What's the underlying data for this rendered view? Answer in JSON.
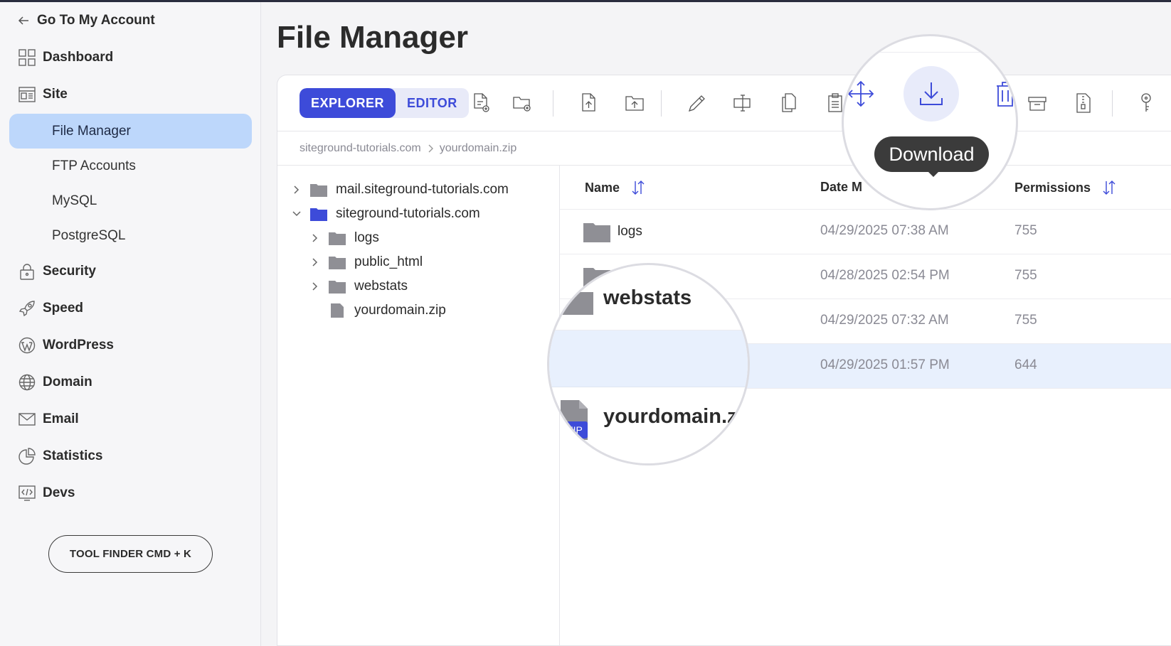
{
  "sidebar": {
    "back_label": "Go To My Account",
    "items": [
      {
        "label": "Dashboard",
        "icon": "dashboard-icon"
      },
      {
        "label": "Site",
        "icon": "site-icon"
      }
    ],
    "site_sub": [
      "File Manager",
      "FTP Accounts",
      "MySQL",
      "PostgreSQL"
    ],
    "items2": [
      {
        "label": "Security",
        "icon": "lock-icon"
      },
      {
        "label": "Speed",
        "icon": "rocket-icon"
      },
      {
        "label": "WordPress",
        "icon": "wordpress-icon"
      },
      {
        "label": "Domain",
        "icon": "globe-icon"
      },
      {
        "label": "Email",
        "icon": "envelope-icon"
      },
      {
        "label": "Statistics",
        "icon": "pie-chart-icon"
      },
      {
        "label": "Devs",
        "icon": "code-icon"
      }
    ],
    "tool_finder": "TOOL FINDER CMD + K"
  },
  "main": {
    "title": "File Manager",
    "tabs": [
      "EXPLORER",
      "EDITOR"
    ],
    "breadcrumb": [
      "siteground-tutorials.com",
      "yourdomain.zip"
    ],
    "tree": [
      {
        "label": "mail.siteground-tutorials.com"
      },
      {
        "label": "siteground-tutorials.com"
      },
      {
        "label": "logs"
      },
      {
        "label": "public_html"
      },
      {
        "label": "webstats"
      },
      {
        "label": "yourdomain.zip"
      }
    ],
    "columns": {
      "name": "Name",
      "date": "Date M",
      "permissions": "Permissions"
    },
    "rows": [
      {
        "name": "logs",
        "date": "04/29/2025 07:38 AM",
        "perm": "755"
      },
      {
        "name": "",
        "date": "04/28/2025 02:54 PM",
        "perm": "755"
      },
      {
        "name": "",
        "date": "04/29/2025 07:32 AM",
        "perm": "755"
      },
      {
        "name": "",
        "date": "04/29/2025 01:57 PM",
        "perm": "644"
      }
    ],
    "tooltip": "Download",
    "mag_names": [
      "webstats",
      "yourdomain.zip"
    ],
    "zip_badge": ".ZIP"
  },
  "colors": {
    "accent": "#3d4bd9",
    "selected_nav": "#bdd7fb",
    "selected_row": "#e8f0fd"
  }
}
